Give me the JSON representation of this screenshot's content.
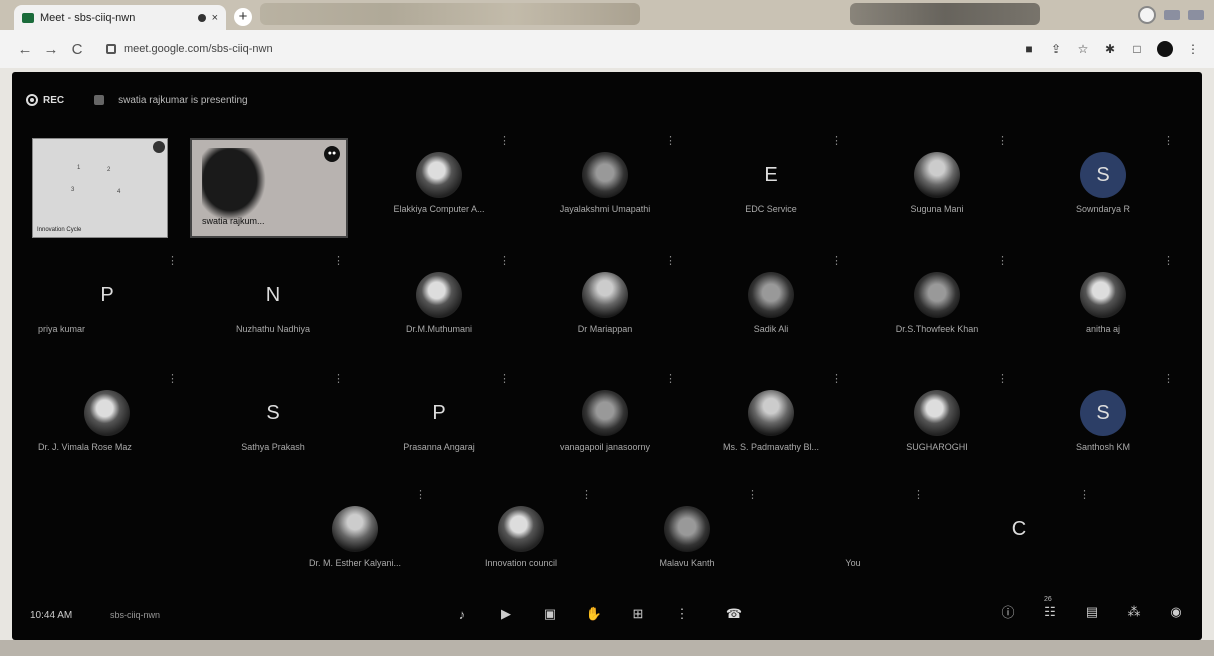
{
  "browser": {
    "tab_title": "Meet - sbs-ciiq-nwn",
    "tab_close": "×",
    "new_tab": "+",
    "url": "meet.google.com/sbs-ciiq-nwn"
  },
  "meet": {
    "recording_label": "REC",
    "recording_text": "swatia rajkumar is presenting",
    "presenter_name": "swatia rajkum...",
    "screen_share_caption": "Innovation Cycle",
    "screen_share_marks": [
      "1",
      "2",
      "3",
      "4"
    ],
    "tiles": [
      {
        "name": "Elakkiya Computer A...",
        "letter": "",
        "style": "photo"
      },
      {
        "name": "Jayalakshmi Umapathi",
        "letter": "",
        "style": "photo2"
      },
      {
        "name": "EDC Service",
        "letter": "E",
        "style": "letter"
      },
      {
        "name": "Suguna Mani",
        "letter": "",
        "style": "photo3"
      },
      {
        "name": "Sowndarya R",
        "letter": "S",
        "style": "circ"
      },
      {
        "name": "priya kumar",
        "letter": "P",
        "style": "letter"
      },
      {
        "name": "Nuzhathu Nadhiya",
        "letter": "N",
        "style": "letter"
      },
      {
        "name": "Dr.M.Muthumani",
        "letter": "",
        "style": "photo"
      },
      {
        "name": "Dr Mariappan",
        "letter": "",
        "style": "photo3"
      },
      {
        "name": "Sadik Ali",
        "letter": "",
        "style": "photo2"
      },
      {
        "name": "Dr.S.Thowfeek Khan",
        "letter": "",
        "style": "photo2"
      },
      {
        "name": "anitha aj",
        "letter": "",
        "style": "photo"
      },
      {
        "name": "Dr. J. Vimala Rose Maz",
        "letter": "",
        "style": "photo"
      },
      {
        "name": "Sathya Prakash",
        "letter": "S",
        "style": "letter"
      },
      {
        "name": "Prasanna Angaraj",
        "letter": "P",
        "style": "letter"
      },
      {
        "name": "vanagapoil janasoorny",
        "letter": "",
        "style": "photo2"
      },
      {
        "name": "Ms. S. Padmavathy Bl...",
        "letter": "",
        "style": "photo3"
      },
      {
        "name": "SUGHAROGHI",
        "letter": "",
        "style": "photo"
      },
      {
        "name": "Santhosh KM",
        "letter": "S",
        "style": "circ"
      },
      {
        "name": "Dr. M. Esther Kalyani...",
        "letter": "",
        "style": "photo3"
      },
      {
        "name": "Innovation council",
        "letter": "",
        "style": "photo"
      },
      {
        "name": "Malavu Kanth",
        "letter": "",
        "style": "photo2"
      },
      {
        "name": "You",
        "letter": "",
        "style": "letter"
      },
      {
        "name": "",
        "letter": "C",
        "style": "letter"
      }
    ],
    "clock": "10:44 AM",
    "meeting_code": "sbs-ciiq-nwn",
    "participants_count": "26",
    "tile_menu": "⋮"
  },
  "icons": {
    "mic": "mic-off-icon",
    "camera": "camera-off-icon",
    "captions": "captions-icon",
    "hand": "raise-hand-icon",
    "present": "present-icon",
    "more": "more-options-icon",
    "end": "end-call-icon",
    "info": "info-icon",
    "people": "people-icon",
    "chat": "chat-icon",
    "activities": "activities-icon",
    "host": "host-controls-icon"
  }
}
